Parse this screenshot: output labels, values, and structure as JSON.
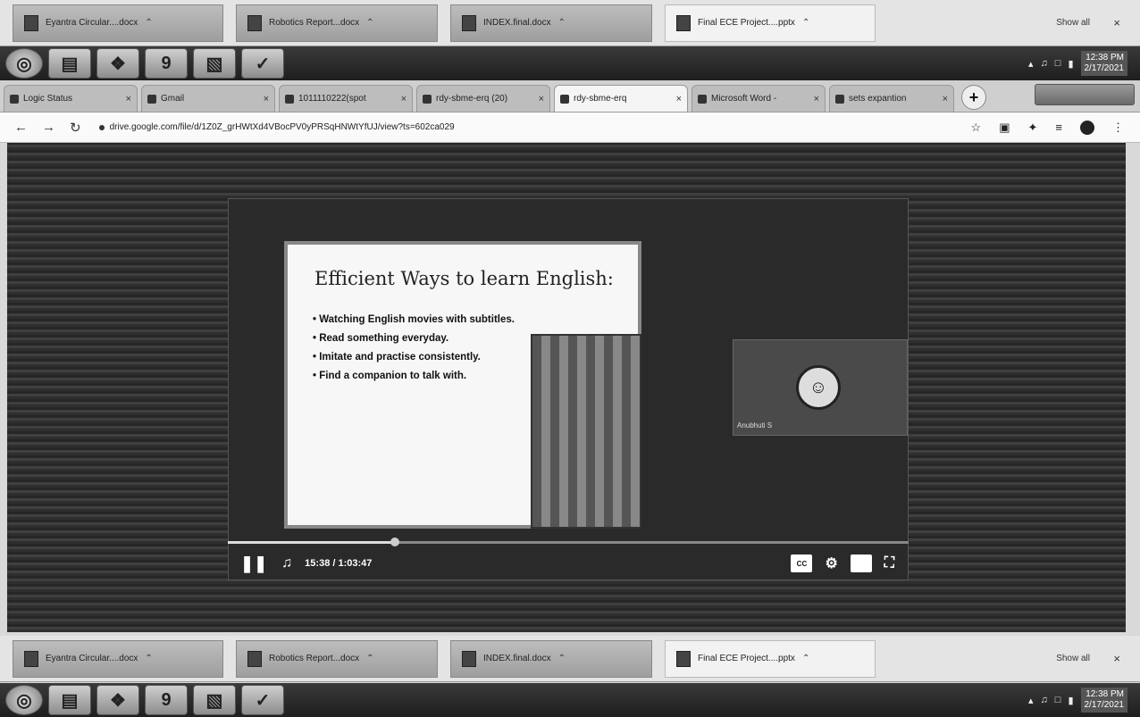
{
  "top_shelf": {
    "items": [
      {
        "label": "Eyantra Circular....docx"
      },
      {
        "label": "Robotics Report...docx"
      },
      {
        "label": "INDEX.final.docx"
      },
      {
        "label": "Final ECE Project....pptx"
      }
    ],
    "show_all": "Show all",
    "close": "×"
  },
  "taskbar_top": {
    "clock_time": "12:38 PM",
    "clock_date": "2/17/2021"
  },
  "browser": {
    "tabs": [
      {
        "label": "Logic Status",
        "active": false
      },
      {
        "label": "Gmail",
        "active": false
      },
      {
        "label": "1011110222(spot",
        "active": false
      },
      {
        "label": "rdy-sbme-erq (20)",
        "active": false
      },
      {
        "label": "rdy-sbme-erq",
        "active": true
      },
      {
        "label": "Microsoft Word -",
        "active": false
      },
      {
        "label": "sets expantion",
        "active": false
      }
    ],
    "new_tab": "+",
    "url": "drive.google.com/file/d/1Z0Z_grHWtXd4VBocPV0yPRSqHNWtYfUJ/view?ts=602ca029"
  },
  "video": {
    "slide_title": "Efficient Ways to learn English:",
    "bullets": [
      "Watching English movies with subtitles.",
      "Read something everyday.",
      "Imitate and practise consistently.",
      "Find a companion to talk with."
    ],
    "participant_name": "Anubhuti S",
    "time_display": "15:38 / 1:03:47",
    "progress_fraction": 0.245,
    "cc_label": "CC"
  },
  "bottom_shelf": {
    "items": [
      {
        "label": "Eyantra Circular....docx"
      },
      {
        "label": "Robotics Report...docx"
      },
      {
        "label": "INDEX.final.docx"
      },
      {
        "label": "Final ECE Project....pptx"
      }
    ],
    "show_all": "Show all",
    "close": "×"
  },
  "taskbar_bottom": {
    "clock_time": "12:38 PM",
    "clock_date": "2/17/2021"
  }
}
